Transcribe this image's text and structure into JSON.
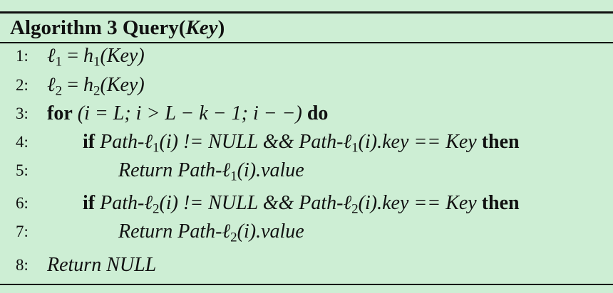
{
  "algorithm": {
    "header_label": "Algorithm 3",
    "name": "Query(",
    "arg": "Key",
    "close": ")"
  },
  "lines": [
    {
      "num": "1:",
      "text": "ℓ1 = h1(Key)"
    },
    {
      "num": "2:",
      "text": "ℓ2 = h2(Key)"
    },
    {
      "num": "3:",
      "text": "for (i = L; i > L − k − 1; i − −) do"
    },
    {
      "num": "4:",
      "text": "if Path-ℓ1(i) != NULL && Path-ℓ1(i).key == Key then"
    },
    {
      "num": "5:",
      "text": "Return Path-ℓ1(i).value"
    },
    {
      "num": "6:",
      "text": "if Path-ℓ2(i) != NULL && Path-ℓ2(i).key == Key then"
    },
    {
      "num": "7:",
      "text": "Return Path-ℓ2(i).value"
    },
    {
      "num": "8:",
      "text": "Return NULL"
    }
  ],
  "tokens": {
    "ell": "ℓ",
    "one": "1",
    "two": "2",
    "eq": " = ",
    "h": "h",
    "key_paren": "(Key)",
    "for": "for",
    "do": "do",
    "for_expr": " (i = L; i > L − k − 1; i − −) ",
    "if": "if",
    "then": "then",
    "path": "Path-",
    "i_paren": "(i)",
    "neq_null": " != NULL && ",
    "dot_key": ".key",
    "eq_key": " == Key ",
    "return": "Return ",
    "dot_value": ".value",
    "return_null": "Return NULL"
  }
}
